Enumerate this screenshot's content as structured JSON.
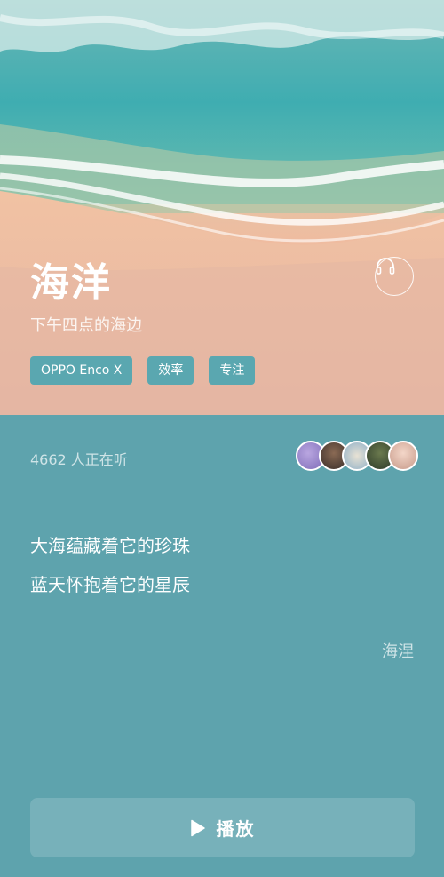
{
  "hero": {
    "title": "海洋",
    "subtitle": "下午四点的海边",
    "headphone_icon": "headphones-icon",
    "tags": [
      "OPPO Enco X",
      "效率",
      "专注"
    ]
  },
  "listening": {
    "count_text": "4662 人正在听",
    "avatar_count": 5
  },
  "poem": {
    "lines": [
      "大海蕴藏着它的珍珠",
      "蓝天怀抱着它的星辰"
    ],
    "author": "海涅"
  },
  "play": {
    "label": "播放",
    "icon": "play-icon"
  },
  "colors": {
    "panel_bg": "#5ea3ad",
    "tag_bg": "#5aa7b0",
    "text": "#ffffff"
  }
}
